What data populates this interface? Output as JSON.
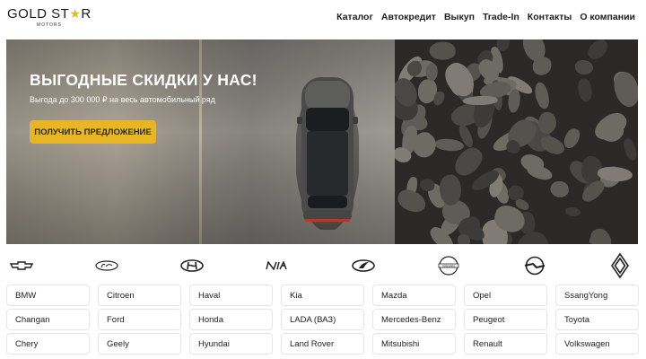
{
  "header": {
    "logo_text_1": "GOLD ST",
    "logo_star": "★",
    "logo_text_2": "R",
    "logo_sub": "MOTORS",
    "nav": [
      "Каталог",
      "Автокредит",
      "Выкуп",
      "Trade-In",
      "Контакты",
      "О компании"
    ]
  },
  "hero": {
    "title": "ВЫГОДНЫЕ СКИДКИ У НАС!",
    "subtitle": "Выгода до 300 000 ₽ на весь автомобильный ряд",
    "button": "ПОЛУЧИТЬ ПРЕДЛОЖЕНИЕ"
  },
  "brand_logos": [
    "chevrolet-logo-icon",
    "ford-logo-icon",
    "hyundai-logo-icon",
    "kia-logo-icon",
    "lada-logo-icon",
    "nissan-logo-icon",
    "opel-logo-icon",
    "renault-logo-icon"
  ],
  "brands": {
    "row1": [
      "BMW",
      "Citroen",
      "Haval",
      "Kia",
      "Mazda",
      "Opel",
      "SsangYong"
    ],
    "row2": [
      "Changan",
      "Ford",
      "Honda",
      "LADA (ВАЗ)",
      "Mercedes-Benz",
      "Peugeot",
      "Toyota"
    ],
    "row3": [
      "Chery",
      "Geely",
      "Hyundai",
      "Land Rover",
      "Mitsubishi",
      "Renault",
      "Volkswagen"
    ]
  },
  "colors": {
    "accent": "#e8b624",
    "text": "#1a1a1a",
    "cell_border": "#e6e6e6"
  }
}
